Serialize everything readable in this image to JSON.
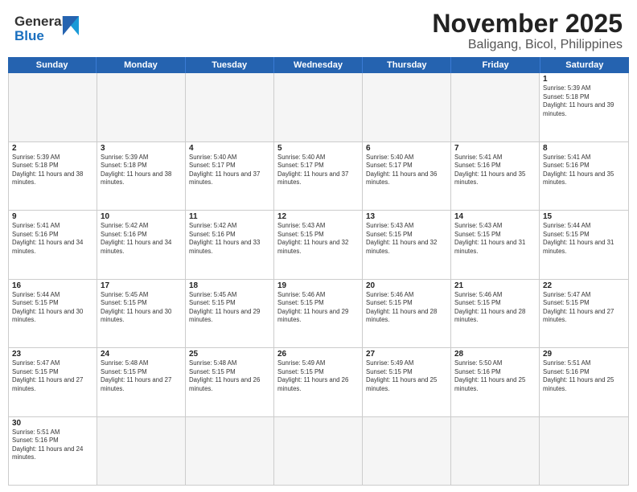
{
  "header": {
    "logo_general": "General",
    "logo_blue": "Blue",
    "title": "November 2025",
    "subtitle": "Baligang, Bicol, Philippines"
  },
  "calendar": {
    "days": [
      "Sunday",
      "Monday",
      "Tuesday",
      "Wednesday",
      "Thursday",
      "Friday",
      "Saturday"
    ],
    "rows": [
      [
        {
          "day": "",
          "empty": true
        },
        {
          "day": "",
          "empty": true
        },
        {
          "day": "",
          "empty": true
        },
        {
          "day": "",
          "empty": true
        },
        {
          "day": "",
          "empty": true
        },
        {
          "day": "",
          "empty": true
        },
        {
          "day": "1",
          "sunrise": "5:39 AM",
          "sunset": "5:18 PM",
          "daylight": "11 hours and 39 minutes."
        }
      ],
      [
        {
          "day": "2",
          "sunrise": "5:39 AM",
          "sunset": "5:18 PM",
          "daylight": "11 hours and 38 minutes."
        },
        {
          "day": "3",
          "sunrise": "5:39 AM",
          "sunset": "5:18 PM",
          "daylight": "11 hours and 38 minutes."
        },
        {
          "day": "4",
          "sunrise": "5:40 AM",
          "sunset": "5:17 PM",
          "daylight": "11 hours and 37 minutes."
        },
        {
          "day": "5",
          "sunrise": "5:40 AM",
          "sunset": "5:17 PM",
          "daylight": "11 hours and 37 minutes."
        },
        {
          "day": "6",
          "sunrise": "5:40 AM",
          "sunset": "5:17 PM",
          "daylight": "11 hours and 36 minutes."
        },
        {
          "day": "7",
          "sunrise": "5:41 AM",
          "sunset": "5:16 PM",
          "daylight": "11 hours and 35 minutes."
        },
        {
          "day": "8",
          "sunrise": "5:41 AM",
          "sunset": "5:16 PM",
          "daylight": "11 hours and 35 minutes."
        }
      ],
      [
        {
          "day": "9",
          "sunrise": "5:41 AM",
          "sunset": "5:16 PM",
          "daylight": "11 hours and 34 minutes."
        },
        {
          "day": "10",
          "sunrise": "5:42 AM",
          "sunset": "5:16 PM",
          "daylight": "11 hours and 34 minutes."
        },
        {
          "day": "11",
          "sunrise": "5:42 AM",
          "sunset": "5:16 PM",
          "daylight": "11 hours and 33 minutes."
        },
        {
          "day": "12",
          "sunrise": "5:43 AM",
          "sunset": "5:15 PM",
          "daylight": "11 hours and 32 minutes."
        },
        {
          "day": "13",
          "sunrise": "5:43 AM",
          "sunset": "5:15 PM",
          "daylight": "11 hours and 32 minutes."
        },
        {
          "day": "14",
          "sunrise": "5:43 AM",
          "sunset": "5:15 PM",
          "daylight": "11 hours and 31 minutes."
        },
        {
          "day": "15",
          "sunrise": "5:44 AM",
          "sunset": "5:15 PM",
          "daylight": "11 hours and 31 minutes."
        }
      ],
      [
        {
          "day": "16",
          "sunrise": "5:44 AM",
          "sunset": "5:15 PM",
          "daylight": "11 hours and 30 minutes."
        },
        {
          "day": "17",
          "sunrise": "5:45 AM",
          "sunset": "5:15 PM",
          "daylight": "11 hours and 30 minutes."
        },
        {
          "day": "18",
          "sunrise": "5:45 AM",
          "sunset": "5:15 PM",
          "daylight": "11 hours and 29 minutes."
        },
        {
          "day": "19",
          "sunrise": "5:46 AM",
          "sunset": "5:15 PM",
          "daylight": "11 hours and 29 minutes."
        },
        {
          "day": "20",
          "sunrise": "5:46 AM",
          "sunset": "5:15 PM",
          "daylight": "11 hours and 28 minutes."
        },
        {
          "day": "21",
          "sunrise": "5:46 AM",
          "sunset": "5:15 PM",
          "daylight": "11 hours and 28 minutes."
        },
        {
          "day": "22",
          "sunrise": "5:47 AM",
          "sunset": "5:15 PM",
          "daylight": "11 hours and 27 minutes."
        }
      ],
      [
        {
          "day": "23",
          "sunrise": "5:47 AM",
          "sunset": "5:15 PM",
          "daylight": "11 hours and 27 minutes."
        },
        {
          "day": "24",
          "sunrise": "5:48 AM",
          "sunset": "5:15 PM",
          "daylight": "11 hours and 27 minutes."
        },
        {
          "day": "25",
          "sunrise": "5:48 AM",
          "sunset": "5:15 PM",
          "daylight": "11 hours and 26 minutes."
        },
        {
          "day": "26",
          "sunrise": "5:49 AM",
          "sunset": "5:15 PM",
          "daylight": "11 hours and 26 minutes."
        },
        {
          "day": "27",
          "sunrise": "5:49 AM",
          "sunset": "5:15 PM",
          "daylight": "11 hours and 25 minutes."
        },
        {
          "day": "28",
          "sunrise": "5:50 AM",
          "sunset": "5:16 PM",
          "daylight": "11 hours and 25 minutes."
        },
        {
          "day": "29",
          "sunrise": "5:51 AM",
          "sunset": "5:16 PM",
          "daylight": "11 hours and 25 minutes."
        }
      ],
      [
        {
          "day": "30",
          "sunrise": "5:51 AM",
          "sunset": "5:16 PM",
          "daylight": "11 hours and 24 minutes."
        },
        {
          "day": "",
          "empty": true
        },
        {
          "day": "",
          "empty": true
        },
        {
          "day": "",
          "empty": true
        },
        {
          "day": "",
          "empty": true
        },
        {
          "day": "",
          "empty": true
        },
        {
          "day": "",
          "empty": true
        }
      ]
    ]
  }
}
